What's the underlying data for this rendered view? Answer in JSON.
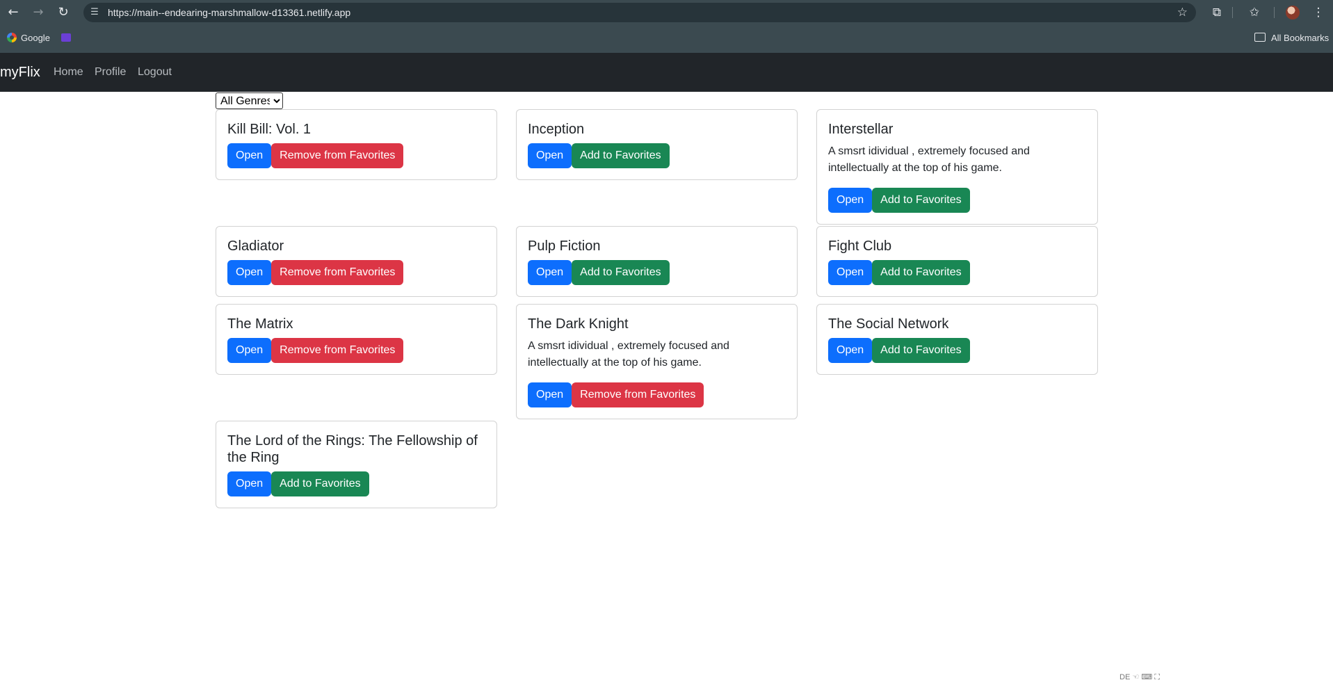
{
  "browser": {
    "url": "https://main--endearing-marshmallow-d13361.netlify.app",
    "bookmarks": [
      {
        "label": "Google",
        "icon": "google-icon"
      },
      {
        "label": "",
        "icon": "mail-icon"
      }
    ],
    "all_bookmarks_label": "All Bookmarks"
  },
  "navbar": {
    "brand": "myFlix",
    "links": [
      "Home",
      "Profile",
      "Logout"
    ]
  },
  "genre_filter": {
    "selected": "All Genres"
  },
  "colors": {
    "open": "#0d6efd",
    "remove": "#dc3545",
    "add": "#198754",
    "navbar": "#212529"
  },
  "movies": [
    {
      "title": "Kill Bill: Vol. 1",
      "description": "",
      "open_label": "Open",
      "favorite_label": "Remove from Favorites",
      "favorite": true
    },
    {
      "title": "Inception",
      "description": "",
      "open_label": "Open",
      "favorite_label": "Add to Favorites",
      "favorite": false
    },
    {
      "title": "Interstellar",
      "description": "A smsrt idividual , extremely focused and intellectually at the top of his game.",
      "open_label": "Open",
      "favorite_label": "Add to Favorites",
      "favorite": false
    },
    {
      "title": "Gladiator",
      "description": "",
      "open_label": "Open",
      "favorite_label": "Remove from Favorites",
      "favorite": true
    },
    {
      "title": "Pulp Fiction",
      "description": "",
      "open_label": "Open",
      "favorite_label": "Add to Favorites",
      "favorite": false
    },
    {
      "title": "Fight Club",
      "description": "",
      "open_label": "Open",
      "favorite_label": "Add to Favorites",
      "favorite": false
    },
    {
      "title": "The Matrix",
      "description": "",
      "open_label": "Open",
      "favorite_label": "Remove from Favorites",
      "favorite": true
    },
    {
      "title": "The Dark Knight",
      "description": "A smsrt idividual , extremely focused and intellectually at the top of his game.",
      "open_label": "Open",
      "favorite_label": "Remove from Favorites",
      "favorite": true
    },
    {
      "title": "The Social Network",
      "description": "",
      "open_label": "Open",
      "favorite_label": "Add to Favorites",
      "favorite": false
    },
    {
      "title": "The Lord of the Rings: The Fellowship of the Ring",
      "description": "",
      "open_label": "Open",
      "favorite_label": "Add to Favorites",
      "favorite": false
    }
  ],
  "footer": {
    "language": "DE"
  }
}
